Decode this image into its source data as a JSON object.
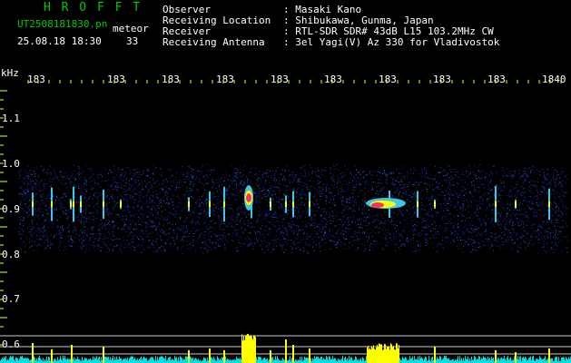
{
  "header": {
    "brand": "H R O F F T",
    "filename": "UT2508181830.pn",
    "meteor_label": "meteor",
    "datetime": "25.08.18 18:30",
    "meteor_count": "33",
    "info_keys": [
      "Observer",
      "Receiving Location",
      "Receiver",
      "Receiving Antenna"
    ],
    "info_values": [
      ": Masaki Kano",
      ": Shibukawa, Gunma, Japan",
      ": RTL-SDR SDR# 43dB L15 103.2MHz CW",
      ": 3el Yagi(V) Az 330 for Vladivostok"
    ]
  },
  "axes": {
    "unit": "kHz",
    "time_ticks": [
      "183",
      "183",
      "183",
      "183",
      "183",
      "183",
      "183",
      "183",
      "183",
      "1840"
    ],
    "freq_ticks": [
      "1.1",
      "1.0",
      "0.9",
      "0.8",
      "0.7",
      "0.6"
    ]
  },
  "colors": {
    "header_green": "#00c800",
    "text_white": "#ffffff",
    "axis_yellow": "#ffff00",
    "noise_blue": "#1a2aa0",
    "baseline_cyan": "#00e0e0",
    "peak_yellow": "#ffff00"
  }
}
